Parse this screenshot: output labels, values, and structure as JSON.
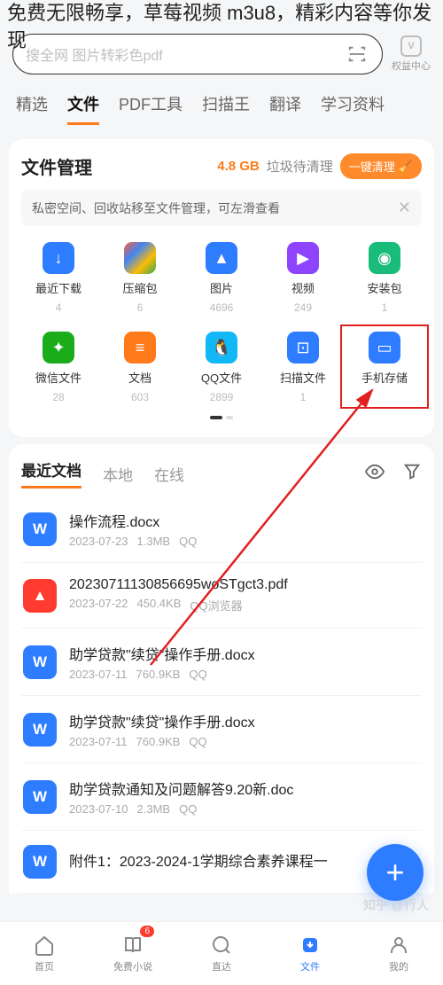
{
  "overlay": "免费无限畅享，草莓视频 m3u8，精彩内容等你发现",
  "search": {
    "placeholder": "搜全网  图片转彩色pdf"
  },
  "rights": {
    "label": "权益中心",
    "icon": "V"
  },
  "tabs": [
    "精选",
    "文件",
    "PDF工具",
    "扫描王",
    "翻译",
    "学习资料"
  ],
  "activeTab": 1,
  "fileCard": {
    "title": "文件管理",
    "junkSize": "4.8 GB",
    "junkText": "垃圾待清理",
    "cleanBtn": "一键清理",
    "notice": "私密空间、回收站移至文件管理，可左滑查看",
    "items": [
      {
        "name": "最近下载",
        "count": "4",
        "bg": "#2e7cff",
        "glyph": "↓"
      },
      {
        "name": "压缩包",
        "count": "6",
        "bg": "linear-gradient(135deg,#ff5e3a,#4285f4,#fbbc05,#34a853)",
        "glyph": ""
      },
      {
        "name": "图片",
        "count": "4696",
        "bg": "#2e7cff",
        "glyph": "▲"
      },
      {
        "name": "视频",
        "count": "249",
        "bg": "#8e44ff",
        "glyph": "▶"
      },
      {
        "name": "安装包",
        "count": "1",
        "bg": "#1abc7a",
        "glyph": "◉"
      },
      {
        "name": "微信文件",
        "count": "28",
        "bg": "#1aad19",
        "glyph": "✦"
      },
      {
        "name": "文档",
        "count": "603",
        "bg": "#ff7a1a",
        "glyph": "≡"
      },
      {
        "name": "QQ文件",
        "count": "2899",
        "bg": "#12b7f5",
        "glyph": "🐧"
      },
      {
        "name": "扫描文件",
        "count": "1",
        "bg": "#2e7cff",
        "glyph": "⊡"
      },
      {
        "name": "手机存储",
        "count": "",
        "bg": "#2e7cff",
        "glyph": "▭",
        "highlight": true
      }
    ]
  },
  "docSection": {
    "tabs": [
      "最近文档",
      "本地",
      "在线"
    ],
    "activeTab": 0,
    "docs": [
      {
        "name": "操作流程.docx",
        "date": "2023-07-23",
        "size": "1.3MB",
        "src": "QQ",
        "type": "W",
        "bg": "#2e7cff"
      },
      {
        "name": "20230711130856695woSTgct3.pdf",
        "date": "2023-07-22",
        "size": "450.4KB",
        "src": "QQ浏览器",
        "type": "▲",
        "bg": "#ff3b30"
      },
      {
        "name": "助学贷款\"续贷\"操作手册.docx",
        "date": "2023-07-11",
        "size": "760.9KB",
        "src": "QQ",
        "type": "W",
        "bg": "#2e7cff"
      },
      {
        "name": "助学贷款\"续贷\"操作手册.docx",
        "date": "2023-07-11",
        "size": "760.9KB",
        "src": "QQ",
        "type": "W",
        "bg": "#2e7cff"
      },
      {
        "name": "助学贷款通知及问题解答9.20新.doc",
        "date": "2023-07-10",
        "size": "2.3MB",
        "src": "QQ",
        "type": "W",
        "bg": "#2e7cff"
      },
      {
        "name": "附件1：2023-2024-1学期综合素养课程一",
        "date": "",
        "size": "",
        "src": "",
        "type": "W",
        "bg": "#2e7cff"
      }
    ]
  },
  "bottomNav": [
    {
      "label": "首页",
      "icon": "home"
    },
    {
      "label": "免费小说",
      "icon": "book",
      "badge": "6"
    },
    {
      "label": "直达",
      "icon": "search"
    },
    {
      "label": "文件",
      "icon": "download",
      "active": true
    },
    {
      "label": "我的",
      "icon": "user"
    }
  ],
  "watermark": "知乎 @行人"
}
